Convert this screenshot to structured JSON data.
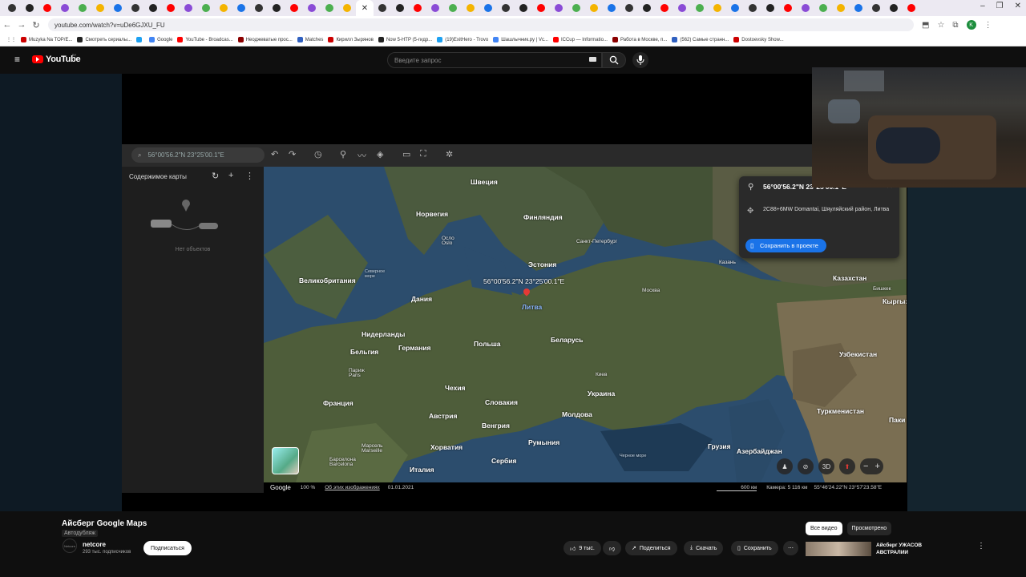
{
  "browser": {
    "url": "youtube.com/watch?v=uDe6GJXU_FU",
    "bookmarks": [
      "Muzyka Na TOP/E...",
      "Смотреть сериалы...",
      "",
      "Google",
      "YouTube - Broadcas...",
      "Неоджеватые прос...",
      "Matches",
      "Кирилл Зырянов",
      "Now 5-HTP (5-гидр...",
      "(19)ExitHero - Trovo",
      "Шашлычник.ру | Vc...",
      "ICCup — Informatio...",
      "Работа в Москве, п...",
      "(562) Самые странн...",
      "Dostoevsky Show..."
    ],
    "tabs_count": 52
  },
  "youtube": {
    "logo": "YouTube",
    "region": "BY",
    "search_placeholder": "Введите запрос"
  },
  "earth": {
    "search_value": "56°00'56.2\"N 23°25'00.1\"E",
    "sidebar_title": "Содержимое карты",
    "sidebar_empty": "Нет объектов",
    "map_coord_label": "56°00'56.2\"N 23°25'00.1\"E",
    "popup": {
      "coord": "56°00'56.2\"N 23°25'00.1\"E",
      "address": "2C88+6MW Domantai, Шяуляйский район, Литва",
      "save": "Сохранить в проекте"
    },
    "footer": {
      "brand": "Google",
      "zoom": "100 %",
      "about": "Об этих изображениях",
      "date": "01.01.2021",
      "scale": "600 км",
      "camera": "Камера: 5 116 км",
      "cursor": "55°46'24.22\"N 23°57'23.58\"E"
    },
    "ctl_3d": "3D",
    "labels": [
      {
        "t": "Швеция",
        "c": "big"
      },
      {
        "t": "Норвегия",
        "c": "big"
      },
      {
        "t": "Финляндия",
        "c": "big"
      },
      {
        "t": "Осло",
        "c": "sm"
      },
      {
        "t": "Oslo",
        "c": "sm"
      },
      {
        "t": "Санкт-Петербург",
        "c": "sm"
      },
      {
        "t": "Эстония",
        "c": "big"
      },
      {
        "t": "Великобритания",
        "c": "big"
      },
      {
        "t": "Северное",
        "c": "sea"
      },
      {
        "t": "море",
        "c": "sea"
      },
      {
        "t": "Дания",
        "c": "big"
      },
      {
        "t": "Литва",
        "c": "big"
      },
      {
        "t": "Москва",
        "c": "sm"
      },
      {
        "t": "Нидерланды",
        "c": "big"
      },
      {
        "t": "Беларусь",
        "c": "big"
      },
      {
        "t": "Польша",
        "c": "big"
      },
      {
        "t": "Германия",
        "c": "big"
      },
      {
        "t": "Бельгия",
        "c": "big"
      },
      {
        "t": "Париж",
        "c": "sm"
      },
      {
        "t": "Paris",
        "c": "sm"
      },
      {
        "t": "Чехия",
        "c": "big"
      },
      {
        "t": "Киев",
        "c": "sm"
      },
      {
        "t": "Украина",
        "c": "big"
      },
      {
        "t": "Франция",
        "c": "big"
      },
      {
        "t": "Словакия",
        "c": "big"
      },
      {
        "t": "Австрия",
        "c": "big"
      },
      {
        "t": "Молдова",
        "c": "big"
      },
      {
        "t": "Венгрия",
        "c": "big"
      },
      {
        "t": "Румыния",
        "c": "big"
      },
      {
        "t": "Хорватия",
        "c": "big"
      },
      {
        "t": "Марсель",
        "c": "sm"
      },
      {
        "t": "Marseille",
        "c": "sm"
      },
      {
        "t": "Барселона",
        "c": "sm"
      },
      {
        "t": "Barcelona",
        "c": "sm"
      },
      {
        "t": "Сербия",
        "c": "big"
      },
      {
        "t": "Италия",
        "c": "big"
      },
      {
        "t": "Черное море",
        "c": "sea"
      },
      {
        "t": "Грузия",
        "c": "big"
      },
      {
        "t": "Азербайджан",
        "c": "big"
      },
      {
        "t": "Тбилиси",
        "c": "sm"
      },
      {
        "t": "Казань",
        "c": "sm"
      },
      {
        "t": "Казахстан",
        "c": "big"
      },
      {
        "t": "Бишкек",
        "c": "sm"
      },
      {
        "t": "Кыргыз",
        "c": "big"
      },
      {
        "t": "Узбекистан",
        "c": "big"
      },
      {
        "t": "Туркменистан",
        "c": "big"
      },
      {
        "t": "Паки",
        "c": "big"
      }
    ]
  },
  "video": {
    "title": "Айсберг Google Maps",
    "dubbed": "Автодубляж",
    "channel": "netcore",
    "channel_avatar": "Netcore",
    "subscribers": "293 тыс. подписчиков",
    "subscribe": "Подписаться",
    "likes": "9 тыс.",
    "share": "Поделиться",
    "download": "Скачать",
    "save": "Сохранить",
    "more": "⋯",
    "chips": [
      "Все видео",
      "Просмотрено"
    ],
    "rec_title": "Айсберг УЖАСОВ АВСТРАЛИИ"
  }
}
